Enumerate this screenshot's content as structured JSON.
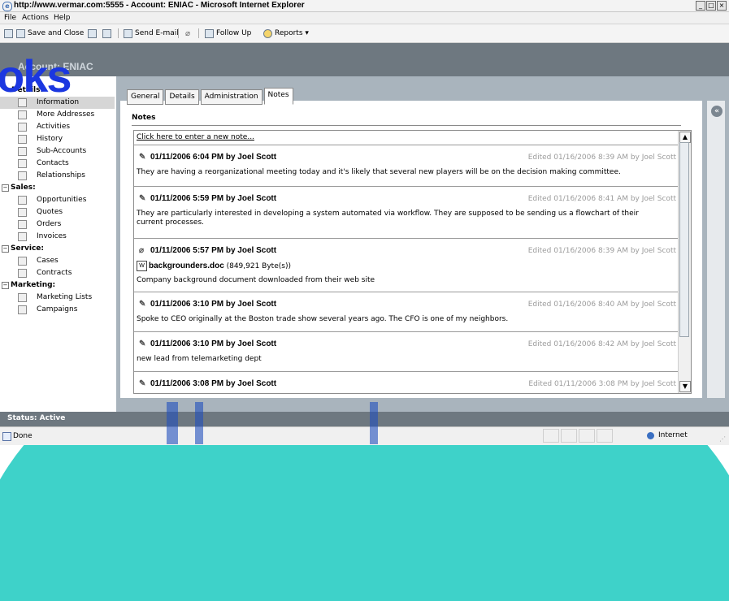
{
  "titlebar": {
    "title": "http://www.vermar.com:5555 - Account: ENIAC - Microsoft Internet Explorer",
    "controls": [
      "_",
      "□",
      "×"
    ]
  },
  "menu": {
    "items": [
      "File",
      "Actions",
      "Help"
    ]
  },
  "toolbar": {
    "save_and_close": "Save and Close",
    "send_email": "Send E-mail",
    "follow_up": "Follow Up",
    "reports": "Reports ▾"
  },
  "header": {
    "account_label": "Account: ENIAC"
  },
  "watermark": {
    "text": "oks"
  },
  "sidebar": {
    "details": {
      "label": "Details:",
      "items": [
        "Information",
        "More Addresses",
        "Activities",
        "History",
        "Sub-Accounts",
        "Contacts",
        "Relationships"
      ]
    },
    "sales": {
      "label": "Sales:",
      "items": [
        "Opportunities",
        "Quotes",
        "Orders",
        "Invoices"
      ]
    },
    "service": {
      "label": "Service:",
      "items": [
        "Cases",
        "Contracts"
      ]
    },
    "marketing": {
      "label": "Marketing:",
      "items": [
        "Marketing Lists",
        "Campaigns"
      ]
    }
  },
  "tabs": [
    "General",
    "Details",
    "Administration",
    "Notes"
  ],
  "notes": {
    "title": "Notes",
    "new_note": "Click here to enter a new note...",
    "items": [
      {
        "header": "01/11/2006 6:04 PM by Joel Scott",
        "edited": "Edited 01/16/2006 8:39 AM by Joel Scott",
        "body": "They are having a reorganizational meeting today and it's likely that several new players will be on the decision making committee."
      },
      {
        "header": "01/11/2006 5:59 PM by Joel Scott",
        "edited": "Edited 01/16/2006 8:41 AM by Joel Scott",
        "body": "They are particularly interested in developing a system automated via workflow. They are supposed to be sending us a flowchart of their current processes."
      },
      {
        "header": "01/11/2006 5:57 PM by Joel Scott",
        "edited": "Edited 01/16/2006 8:39 AM by Joel Scott",
        "attachment_name": "backgrounders.doc",
        "attachment_size": "(849,921 Byte(s))",
        "body": "Company background document downloaded from their web site"
      },
      {
        "header": "01/11/2006 3:10 PM by Joel Scott",
        "edited": "Edited 01/16/2006 8:40 AM by Joel Scott",
        "body": "Spoke to CEO originally at the Boston trade show several years ago. The CFO is one of my neighbors."
      },
      {
        "header": "01/11/2006 3:10 PM by Joel Scott",
        "edited": "Edited 01/16/2006 8:42 AM by Joel Scott",
        "body": "new lead from telemarketing dept"
      },
      {
        "header": "01/11/2006 3:08 PM by Joel Scott",
        "edited": "Edited 01/11/2006 3:08 PM by Joel Scott",
        "body": ""
      }
    ]
  },
  "status": {
    "text": "Status: Active"
  },
  "ie_status": {
    "done": "Done",
    "zone": "Internet"
  }
}
